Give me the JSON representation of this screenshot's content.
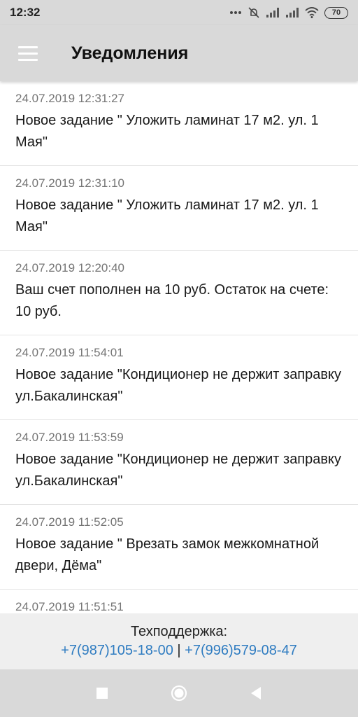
{
  "status_bar": {
    "time": "12:32",
    "battery": "70",
    "icons": [
      "more-dots-icon",
      "mute-icon",
      "signal-icon",
      "signal-icon",
      "wifi-icon",
      "battery-icon"
    ]
  },
  "app_bar": {
    "menu_icon": "hamburger-menu-icon",
    "title": "Уведомления",
    "background": "#d9d9d9"
  },
  "notifications": [
    {
      "date": "24.07.2019 12:31:27",
      "text": "Новое задание \" Уложить ламинат 17 м2. ул. 1 Мая\""
    },
    {
      "date": "24.07.2019 12:31:10",
      "text": "Новое задание \" Уложить ламинат 17 м2. ул. 1 Мая\""
    },
    {
      "date": "24.07.2019 12:20:40",
      "text": "Ваш счет пополнен на 10 руб. Остаток на счете: 10 руб."
    },
    {
      "date": "24.07.2019 11:54:01",
      "text": "Новое задание \"Кондиционер не держит заправку ул.Бакалинская\""
    },
    {
      "date": "24.07.2019 11:53:59",
      "text": "Новое задание \"Кондиционер не держит заправку ул.Бакалинская\""
    },
    {
      "date": "24.07.2019 11:52:05",
      "text": "Новое задание \" Врезать замок межкомнатной двери, Дёма\""
    },
    {
      "date": "24.07.2019 11:51:51",
      "text": ""
    }
  ],
  "support": {
    "title": "Техподдержка:",
    "phone_1": "+7(987)105-18-00",
    "separator": "|",
    "phone_2": "+7(996)579-08-47",
    "link_color": "#2f7cc1"
  },
  "nav_bar": {
    "buttons": [
      "recents-square-icon",
      "home-circle-icon",
      "back-triangle-icon"
    ]
  }
}
